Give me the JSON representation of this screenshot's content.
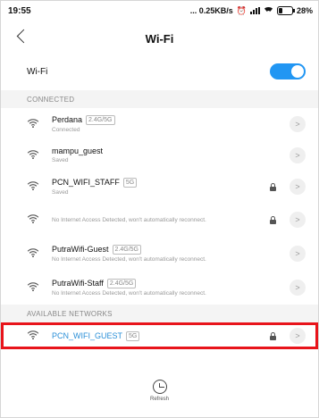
{
  "status_bar": {
    "time": "19:55",
    "indicators": "... 0.25KB/s",
    "battery_text": "28%",
    "battery_level": 0.28
  },
  "header": {
    "back_icon": "chevron-left-icon",
    "title": "Wi-Fi"
  },
  "wifi_toggle": {
    "label": "Wi-Fi",
    "on": true,
    "accent": "#2196f3"
  },
  "connected": {
    "heading": "CONNECTED",
    "networks": [
      {
        "name": "Perdana",
        "tag": "2.4G/5G",
        "status": "Connected",
        "locked": false
      },
      {
        "name": "mampu_guest",
        "tag": "",
        "status": "Saved",
        "locked": false
      },
      {
        "name": "PCN_WIFI_STAFF",
        "tag": "5G",
        "status": "Saved",
        "locked": true
      },
      {
        "name": "",
        "tag": "",
        "status": "No Internet Access Detected, won't automatically reconnect.",
        "locked": true
      },
      {
        "name": "PutraWifi-Guest",
        "tag": "2.4G/5G",
        "status": "No Internet Access Detected, won't automatically reconnect.",
        "locked": false
      },
      {
        "name": "PutraWifi-Staff",
        "tag": "2.4G/5G",
        "status": "No Internet Access Detected, won't automatically reconnect.",
        "locked": false
      }
    ]
  },
  "available": {
    "heading": "AVAILABLE NETWORKS",
    "networks": [
      {
        "name": "PCN_WIFI_GUEST",
        "tag": "5G",
        "status": "",
        "locked": true,
        "highlight_color": "#e8141b",
        "name_color": "#2a8fd8"
      }
    ]
  },
  "refresh": {
    "label": "Refresh"
  }
}
